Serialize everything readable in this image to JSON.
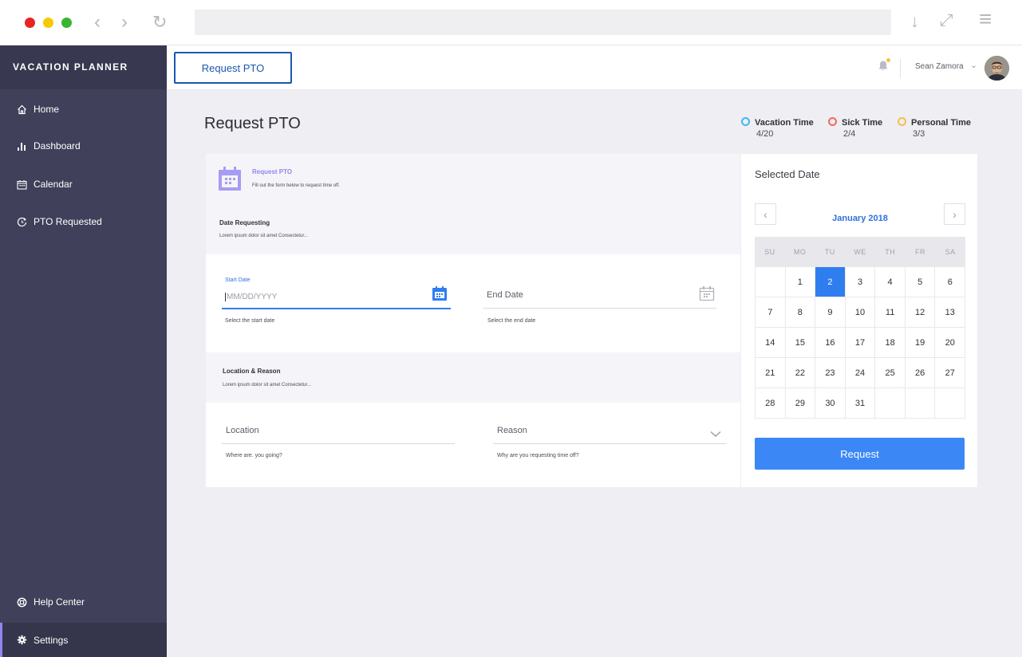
{
  "browser": {
    "back_icon": "‹",
    "forward_icon": "›",
    "reload_icon": "↻",
    "download_icon": "↓",
    "expand_icon": "⤢",
    "menu_icon": "≡"
  },
  "sidebar": {
    "brand": "VACATION PLANNER",
    "items": [
      {
        "label": "Home",
        "icon": "home-icon"
      },
      {
        "label": "Dashboard",
        "icon": "bar-chart-icon"
      },
      {
        "label": "Calendar",
        "icon": "calendar-icon"
      },
      {
        "label": "PTO Requested",
        "icon": "clock-refresh-icon"
      }
    ],
    "bottom_items": [
      {
        "label": "Help Center",
        "icon": "lifebuoy-icon"
      },
      {
        "label": "Settings",
        "icon": "gear-icon",
        "active": true
      }
    ]
  },
  "header": {
    "request_button": "Request PTO",
    "user_name": "Sean Zamora",
    "chevron": "⌄"
  },
  "page": {
    "title": "Request PTO",
    "legend": [
      {
        "label": "Vacation Time",
        "value": "4/20",
        "color": "#3fb8f0"
      },
      {
        "label": "Sick Time",
        "value": "2/4",
        "color": "#ef6b5a"
      },
      {
        "label": "Personal Time",
        "value": "3/3",
        "color": "#f5c04d"
      }
    ]
  },
  "form": {
    "header_title": "Request PTO",
    "header_subtitle": "Fill out the form below to request time off.",
    "date_section_title": "Date Requesting",
    "date_section_desc": "Lorem ipsum dolor sit amet Consectetur...",
    "start_date_label": "Start Date",
    "start_date_placeholder": "MM/DD/YYYY",
    "start_date_helper": "Select the start date",
    "end_date_label": "End Date",
    "end_date_helper": "Select the end date",
    "location_section_title": "Location & Reason",
    "location_section_desc": "Lorem ipsum dolor sit amet Consectetur...",
    "location_label": "Location",
    "location_helper": "Where are. you going?",
    "reason_label": "Reason",
    "reason_helper": "Why are you requesting time off?"
  },
  "calendar": {
    "title": "Selected Date",
    "month": "January 2018",
    "prev_icon": "‹",
    "next_icon": "›",
    "weekdays": [
      "SU",
      "MO",
      "TU",
      "WE",
      "TH",
      "FR",
      "SA"
    ],
    "weeks": [
      [
        "",
        "1",
        "2",
        "3",
        "4",
        "5",
        "6"
      ],
      [
        "7",
        "8",
        "9",
        "10",
        "11",
        "12",
        "13"
      ],
      [
        "14",
        "15",
        "16",
        "17",
        "18",
        "19",
        "20"
      ],
      [
        "21",
        "22",
        "23",
        "24",
        "25",
        "26",
        "27"
      ],
      [
        "28",
        "29",
        "30",
        "31",
        "",
        "",
        ""
      ]
    ],
    "selected_day": "2",
    "request_button": "Request"
  }
}
